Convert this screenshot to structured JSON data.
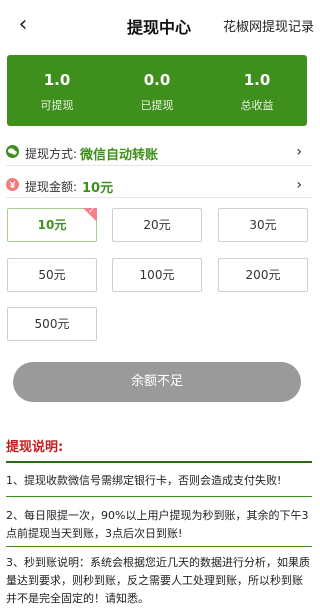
{
  "header": {
    "title": "提现中心",
    "record_link": "花椒网提现记录"
  },
  "summary": [
    {
      "value": "1.0",
      "label": "可提现"
    },
    {
      "value": "0.0",
      "label": "已提现"
    },
    {
      "value": "1.0",
      "label": "总收益"
    }
  ],
  "method": {
    "label": "提现方式:",
    "value": "微信自动转账"
  },
  "amount": {
    "label": "提现金额:",
    "value": "10元"
  },
  "amount_options": [
    "10元",
    "20元",
    "30元",
    "50元",
    "100元",
    "200元",
    "500元"
  ],
  "selected_amount": "10元",
  "submit": {
    "label": "余额不足"
  },
  "instructions": {
    "title": "提现说明:",
    "items": [
      "1、提现收款微信号需绑定银行卡，否则会造成支付失败!",
      "2、每日限提一次，90%以上用户提现为秒到账，其余的下午3点前提现当天到账，3点后次日到账!",
      "3、秒到账说明：系统会根据您近几天的数据进行分析，如果质量达到要求，则秒到账，反之需要人工处理到账，所以秒到账并不是完全固定的！请知悉。"
    ]
  },
  "colors": {
    "accent": "#3f8f1d",
    "alert": "#c51d1d",
    "disabled": "#9a9a9a"
  },
  "icons": {
    "back": "chevron-left-icon",
    "method": "wechat-icon",
    "amount": "yuan-icon",
    "arrow": "chevron-right-icon",
    "corner": "selected-corner-icon"
  }
}
